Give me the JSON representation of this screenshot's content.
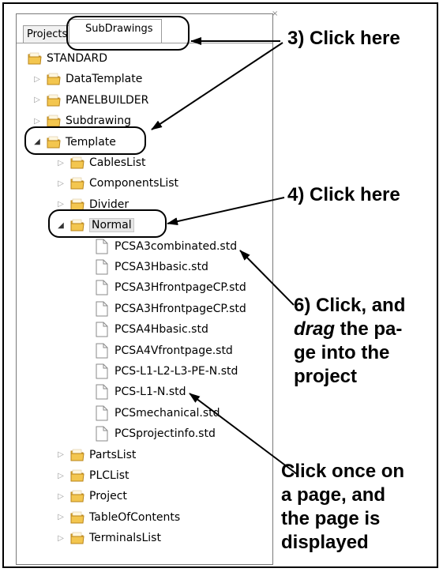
{
  "tabs": {
    "projects": "Projects",
    "subdrawings": "SubDrawings"
  },
  "tree": {
    "root": "STANDARD",
    "level1_top": [
      "DataTemplate",
      "PANELBUILDER",
      "Subdrawing"
    ],
    "template": "Template",
    "template_children_top": [
      "CablesList",
      "ComponentsList",
      "Divider"
    ],
    "normal": "Normal",
    "normal_files": [
      "PCSA3combinated.std",
      "PCSA3Hbasic.std",
      "PCSA3HfrontpageCP.std",
      "PCSA3HfrontpageCP.std",
      "PCSA4Hbasic.std",
      "PCSA4Vfrontpage.std",
      "PCS-L1-L2-L3-PE-N.std",
      "PCS-L1-N.std",
      "PCSmechanical.std",
      "PCSprojectinfo.std"
    ],
    "template_children_bottom": [
      "PartsList",
      "PLCList",
      "Project",
      "TableOfContents",
      "TerminalsList"
    ]
  },
  "callouts": {
    "c3": "3) Click here",
    "c4": "4) Click here",
    "c6_line1": "6) Click, and",
    "c6_line2_em": "drag",
    "c6_line2_rest": " the pa-",
    "c6_line3": "ge into the",
    "c6_line4": "project",
    "c7_line1": "Click once on",
    "c7_line2": "a page, and",
    "c7_line3": "the page is",
    "c7_line4": "displayed"
  },
  "icons": {
    "collapsed": "triangle-right",
    "expanded": "triangle-down",
    "folder": "folder-icon",
    "file": "document-icon"
  }
}
